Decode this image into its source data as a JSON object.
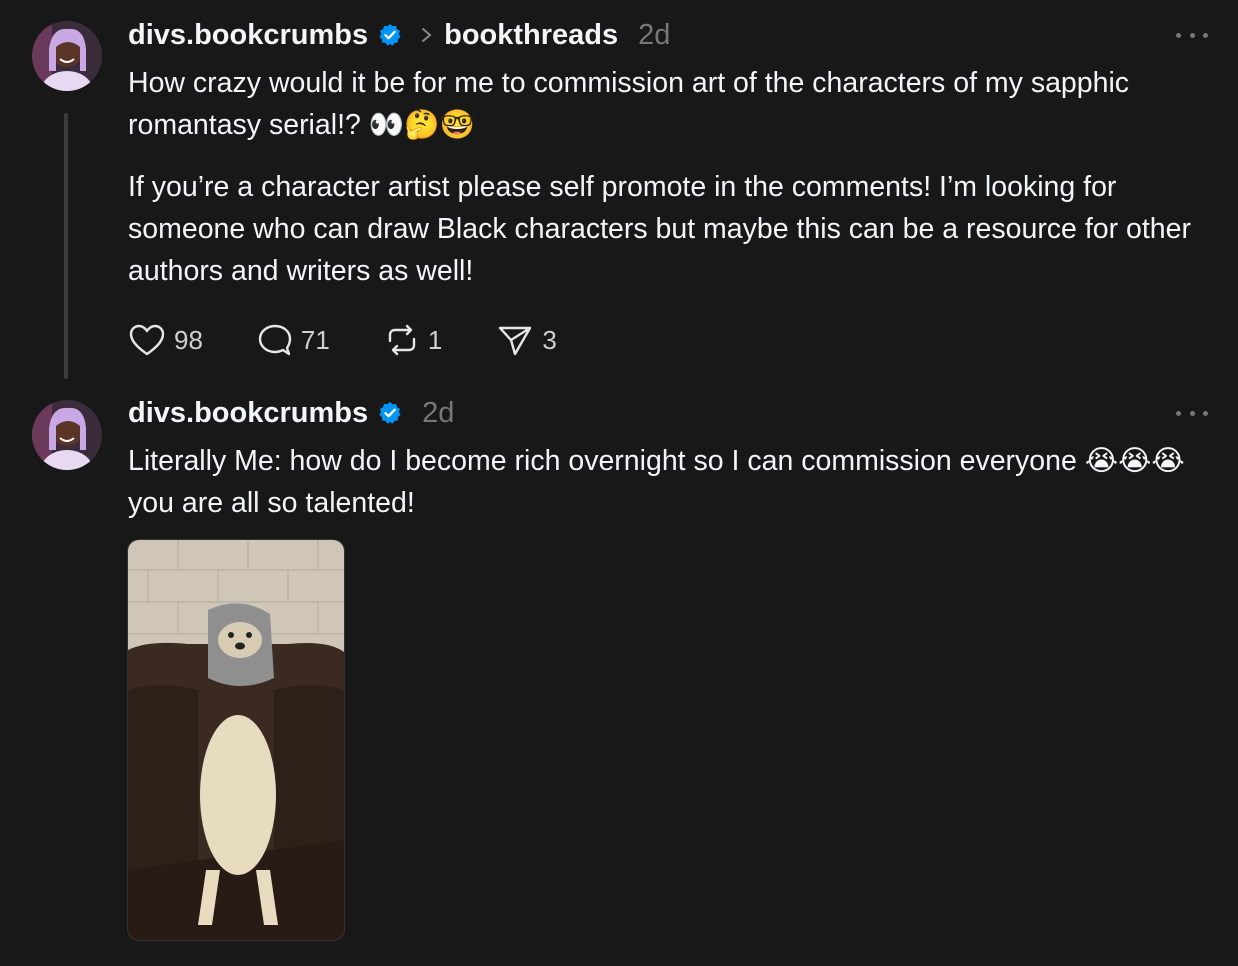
{
  "posts": [
    {
      "username": "divs.bookcrumbs",
      "topic": "bookthreads",
      "time": "2d",
      "paragraphs": [
        "How crazy would it be for me to commission art of the characters of my sapphic romantasy serial!? 👀🤔🤓",
        "If you’re a character artist please self promote in the comments! I’m looking for someone who can draw Black characters but maybe this can be a resource for other authors and writers as well!"
      ],
      "likes": "98",
      "replies": "71",
      "reposts": "1",
      "shares": "3"
    },
    {
      "username": "divs.bookcrumbs",
      "time": "2d",
      "paragraphs": [
        "Literally Me: how do I become rich overnight so I can commission everyone 😭😭😭 you are all so talented!"
      ]
    }
  ],
  "colors": {
    "background": "#181818",
    "text": "#f3f5f7",
    "muted": "#777777",
    "verified": "#0095f6"
  },
  "icons": [
    "verified-badge-icon",
    "chevron-right-icon",
    "more-icon",
    "heart-icon",
    "comment-icon",
    "repost-icon",
    "share-icon"
  ]
}
